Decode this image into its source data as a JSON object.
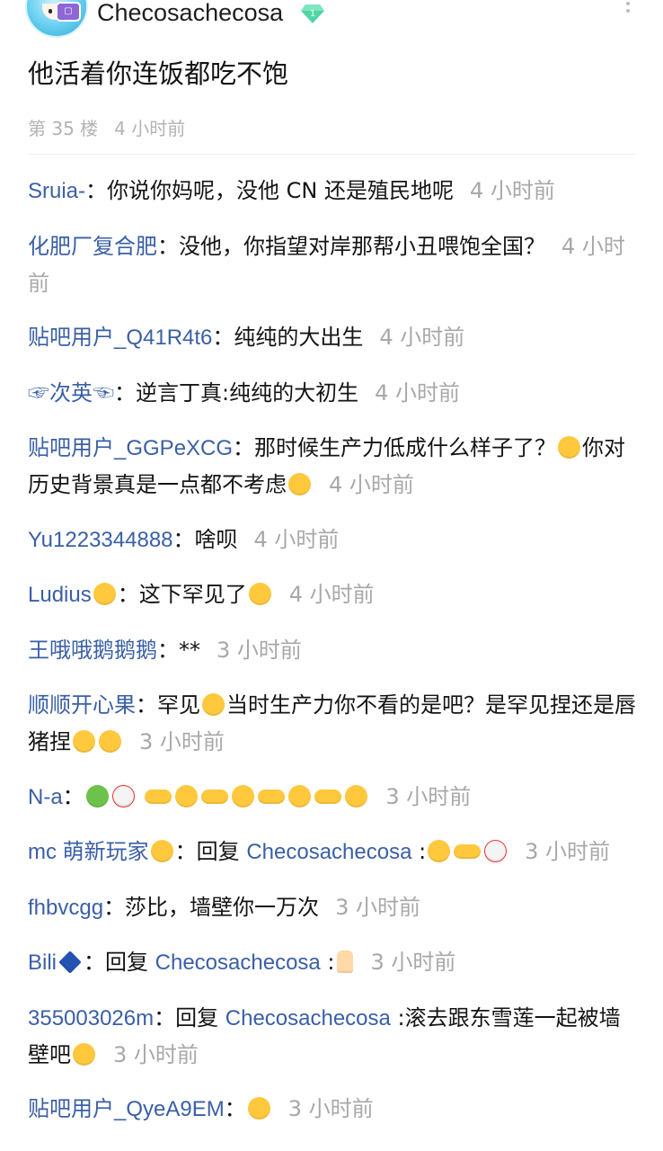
{
  "post": {
    "username": "Checosachecosa",
    "text": "他活着你连饭都吃不饱",
    "floor": "第 35 楼",
    "time": "4 小时前"
  },
  "replies": [
    {
      "author": "Sruia-",
      "pre": "：你说你妈呢，没他 CN 还是殖民地呢",
      "time": "4 小时前"
    },
    {
      "author": "化肥厂复合肥",
      "pre": "：没他，你指望对岸那帮小丑喂饱全国？",
      "time": "4 小时前"
    },
    {
      "author": "贴吧用户_Q41R4t6",
      "pre": "：纯纯的大出生",
      "time": "4 小时前"
    },
    {
      "author": "☞次英☜",
      "pre": "：逆言丁真:纯纯的大初生",
      "time": "4 小时前"
    },
    {
      "author": "贴吧用户_GGPeXCG",
      "pre": "：那时候生产力低成什么样子了？",
      "post": "你对历史背景真是一点都不考虑",
      "time": "4 小时前"
    },
    {
      "author": "Yu1223344888",
      "pre": "：啥呗",
      "time": "4 小时前"
    },
    {
      "author": "Ludius",
      "pre": "：这下罕见了",
      "time": "4 小时前"
    },
    {
      "author": "王哦哦鹅鹅鹅",
      "pre": "：**",
      "time": "3 小时前"
    },
    {
      "author": "顺顺开心果",
      "pre": "：罕见",
      "post": "当时生产力你不看的是吧？是罕见捏还是唇猪捏",
      "time": "3 小时前"
    },
    {
      "author": "N-a",
      "pre": "：",
      "time": "3 小时前"
    },
    {
      "author": "mc 萌新玩家",
      "pre": "：回复 ",
      "mention": "Checosachecosa",
      "post": " :",
      "time": "3 小时前"
    },
    {
      "author": "fhbvcgg",
      "pre": "：莎比，墙壁你一万次",
      "time": "3 小时前"
    },
    {
      "author": "Bili",
      "pre": "：回复 ",
      "mention": "Checosachecosa",
      "post": " :",
      "time": "3 小时前"
    },
    {
      "author": "355003026m",
      "pre": "：回复 ",
      "mention": "Checosachecosa",
      "post": " :滚去跟东雪莲一起被墙壁吧",
      "time": "3 小时前"
    },
    {
      "author": "贴吧用户_QyeA9EM",
      "pre": "：",
      "time": "3 小时前"
    }
  ]
}
